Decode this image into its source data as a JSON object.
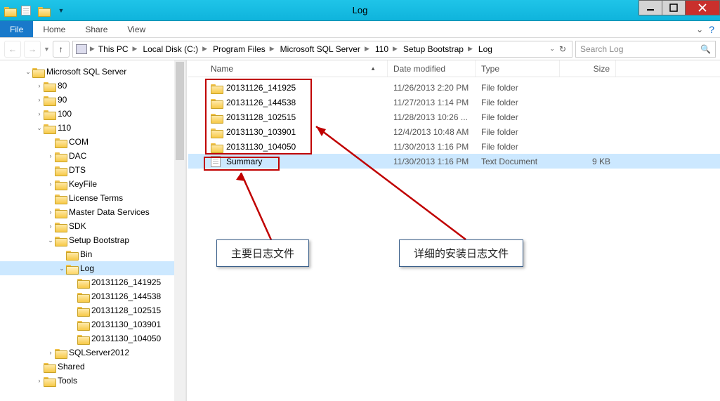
{
  "window": {
    "title": "Log"
  },
  "ribbon": {
    "file": "File",
    "tabs": [
      "Home",
      "Share",
      "View"
    ]
  },
  "breadcrumb": {
    "items": [
      "This PC",
      "Local Disk (C:)",
      "Program Files",
      "Microsoft SQL Server",
      "110",
      "Setup Bootstrap",
      "Log"
    ]
  },
  "search": {
    "placeholder": "Search Log"
  },
  "tree": [
    {
      "d": 1,
      "exp": "open",
      "icon": "folder",
      "label": "Microsoft SQL Server"
    },
    {
      "d": 2,
      "exp": "closed",
      "icon": "folder",
      "label": "80"
    },
    {
      "d": 2,
      "exp": "closed",
      "icon": "folder",
      "label": "90"
    },
    {
      "d": 2,
      "exp": "closed",
      "icon": "folder",
      "label": "100"
    },
    {
      "d": 2,
      "exp": "open",
      "icon": "folder",
      "label": "110"
    },
    {
      "d": 3,
      "exp": "none",
      "icon": "folder",
      "label": "COM"
    },
    {
      "d": 3,
      "exp": "closed",
      "icon": "folder",
      "label": "DAC"
    },
    {
      "d": 3,
      "exp": "none",
      "icon": "folder",
      "label": "DTS"
    },
    {
      "d": 3,
      "exp": "closed",
      "icon": "folder",
      "label": "KeyFile"
    },
    {
      "d": 3,
      "exp": "none",
      "icon": "folder",
      "label": "License Terms"
    },
    {
      "d": 3,
      "exp": "closed",
      "icon": "folder",
      "label": "Master Data Services"
    },
    {
      "d": 3,
      "exp": "closed",
      "icon": "folder",
      "label": "SDK"
    },
    {
      "d": 3,
      "exp": "open",
      "icon": "folder",
      "label": "Setup Bootstrap"
    },
    {
      "d": 4,
      "exp": "none",
      "icon": "folder",
      "label": "Bin"
    },
    {
      "d": 4,
      "exp": "open",
      "icon": "folder-open",
      "label": "Log",
      "sel": true
    },
    {
      "d": 5,
      "exp": "none",
      "icon": "folder",
      "label": "20131126_141925"
    },
    {
      "d": 5,
      "exp": "none",
      "icon": "folder",
      "label": "20131126_144538"
    },
    {
      "d": 5,
      "exp": "none",
      "icon": "folder",
      "label": "20131128_102515"
    },
    {
      "d": 5,
      "exp": "none",
      "icon": "folder",
      "label": "20131130_103901"
    },
    {
      "d": 5,
      "exp": "none",
      "icon": "folder",
      "label": "20131130_104050"
    },
    {
      "d": 3,
      "exp": "closed",
      "icon": "folder",
      "label": "SQLServer2012"
    },
    {
      "d": 2,
      "exp": "none",
      "icon": "folder",
      "label": "Shared"
    },
    {
      "d": 2,
      "exp": "closed",
      "icon": "folder",
      "label": "Tools"
    }
  ],
  "columns": {
    "name": "Name",
    "date": "Date modified",
    "type": "Type",
    "size": "Size"
  },
  "files": [
    {
      "icon": "folder",
      "name": "20131126_141925",
      "date": "11/26/2013 2:20 PM",
      "type": "File folder",
      "size": ""
    },
    {
      "icon": "folder",
      "name": "20131126_144538",
      "date": "11/27/2013 1:14 PM",
      "type": "File folder",
      "size": ""
    },
    {
      "icon": "folder",
      "name": "20131128_102515",
      "date": "11/28/2013 10:26 ...",
      "type": "File folder",
      "size": ""
    },
    {
      "icon": "folder",
      "name": "20131130_103901",
      "date": "12/4/2013 10:48 AM",
      "type": "File folder",
      "size": ""
    },
    {
      "icon": "folder",
      "name": "20131130_104050",
      "date": "11/30/2013 1:16 PM",
      "type": "File folder",
      "size": ""
    },
    {
      "icon": "file",
      "name": "Summary",
      "date": "11/30/2013 1:16 PM",
      "type": "Text Document",
      "size": "9 KB",
      "sel": true
    }
  ],
  "annotations": {
    "callout1": "主要日志文件",
    "callout2": "详细的安装日志文件"
  }
}
